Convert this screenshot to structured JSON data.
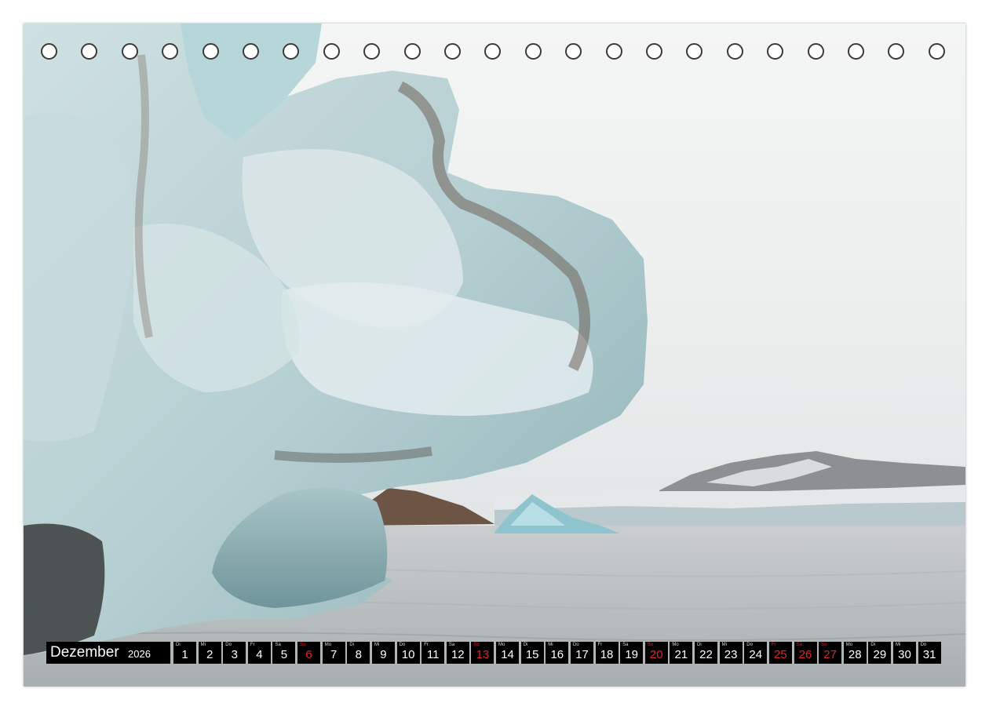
{
  "calendar": {
    "month": "Dezember",
    "year": "2026",
    "days": [
      {
        "wd": "Di",
        "num": "1",
        "red": false
      },
      {
        "wd": "Mi",
        "num": "2",
        "red": false
      },
      {
        "wd": "Do",
        "num": "3",
        "red": false
      },
      {
        "wd": "Fr",
        "num": "4",
        "red": false
      },
      {
        "wd": "Sa",
        "num": "5",
        "red": false
      },
      {
        "wd": "So",
        "num": "6",
        "red": true
      },
      {
        "wd": "Mo",
        "num": "7",
        "red": false
      },
      {
        "wd": "Di",
        "num": "8",
        "red": false
      },
      {
        "wd": "Mi",
        "num": "9",
        "red": false
      },
      {
        "wd": "Do",
        "num": "10",
        "red": false
      },
      {
        "wd": "Fr",
        "num": "11",
        "red": false
      },
      {
        "wd": "Sa",
        "num": "12",
        "red": false
      },
      {
        "wd": "So",
        "num": "13",
        "red": true
      },
      {
        "wd": "Mo",
        "num": "14",
        "red": false
      },
      {
        "wd": "Di",
        "num": "15",
        "red": false
      },
      {
        "wd": "Mi",
        "num": "16",
        "red": false
      },
      {
        "wd": "Do",
        "num": "17",
        "red": false
      },
      {
        "wd": "Fr",
        "num": "18",
        "red": false
      },
      {
        "wd": "Sa",
        "num": "19",
        "red": false
      },
      {
        "wd": "So",
        "num": "20",
        "red": true
      },
      {
        "wd": "Mo",
        "num": "21",
        "red": false
      },
      {
        "wd": "Di",
        "num": "22",
        "red": false
      },
      {
        "wd": "Mi",
        "num": "23",
        "red": false
      },
      {
        "wd": "Do",
        "num": "24",
        "red": false
      },
      {
        "wd": "Fr",
        "num": "25",
        "red": true
      },
      {
        "wd": "Sa",
        "num": "26",
        "red": true
      },
      {
        "wd": "So",
        "num": "27",
        "red": true
      },
      {
        "wd": "Mo",
        "num": "28",
        "red": false
      },
      {
        "wd": "Di",
        "num": "29",
        "red": false
      },
      {
        "wd": "Mi",
        "num": "30",
        "red": false
      },
      {
        "wd": "Do",
        "num": "31",
        "red": false
      }
    ]
  },
  "binding": {
    "hole_count": 23
  },
  "colors": {
    "holiday": "#e3242b",
    "cell_bg": "#000000",
    "text": "#ffffff"
  }
}
